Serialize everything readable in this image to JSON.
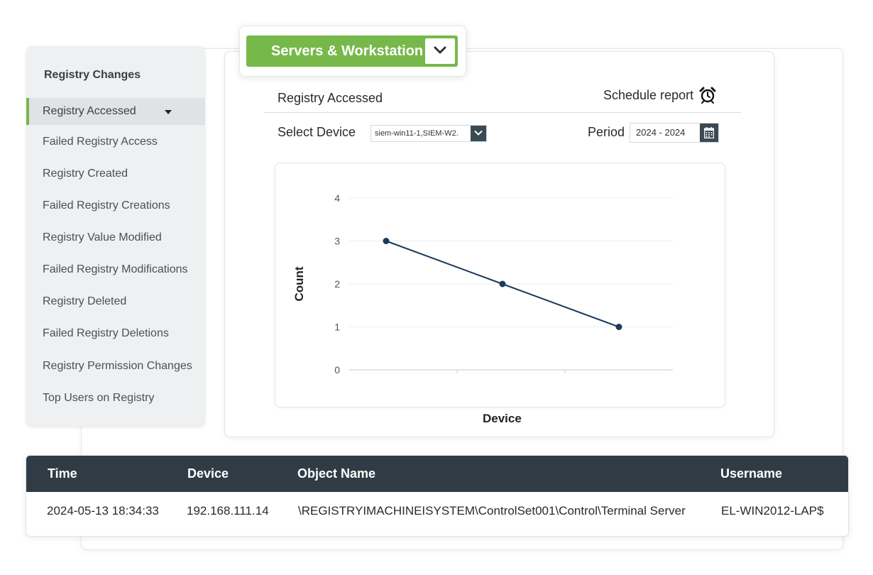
{
  "dropdown": {
    "label": "Servers & Workstation",
    "icon": "chevron-down-icon"
  },
  "sidebar": {
    "title": "Registry Changes",
    "items": [
      {
        "label": "Registry Accessed",
        "active": true
      },
      {
        "label": "Failed Registry Access"
      },
      {
        "label": "Registry Created"
      },
      {
        "label": "Failed Registry Creations"
      },
      {
        "label": "Registry Value Modified"
      },
      {
        "label": "Failed Registry Modifications"
      },
      {
        "label": "Registry Deleted"
      },
      {
        "label": "Failed Registry Deletions"
      },
      {
        "label": "Registry Permission Changes"
      },
      {
        "label": "Top Users on Registry"
      }
    ]
  },
  "report": {
    "title": "Registry Accessed",
    "schedule_label": "Schedule report",
    "select_device_label": "Select Device",
    "device_value": "siem-win11-1,SIEM-W2.",
    "period_label": "Period",
    "period_value": "2024 - 2024"
  },
  "chart_data": {
    "type": "line",
    "ylabel": "Count",
    "xlabel": "Device",
    "ylim": [
      0,
      4
    ],
    "yticks": [
      0,
      1,
      2,
      3,
      4
    ],
    "grid": true,
    "series": [
      {
        "values": [
          3,
          2,
          1
        ],
        "color": "#1b3a5c"
      }
    ]
  },
  "table": {
    "headers": [
      "Time",
      "Device",
      "Object Name",
      "Username"
    ],
    "rows": [
      [
        "2024-05-13 18:34:33",
        "192.168.111.14",
        "\\REGISTRYIMACHINEISYSTEM\\ControlSet001\\Control\\Terminal Server",
        "EL-WIN2012-LAP$"
      ]
    ]
  },
  "colors": {
    "accent": "#77b84a",
    "header_dark": "#2f3c45",
    "line": "#1b3a5c"
  }
}
